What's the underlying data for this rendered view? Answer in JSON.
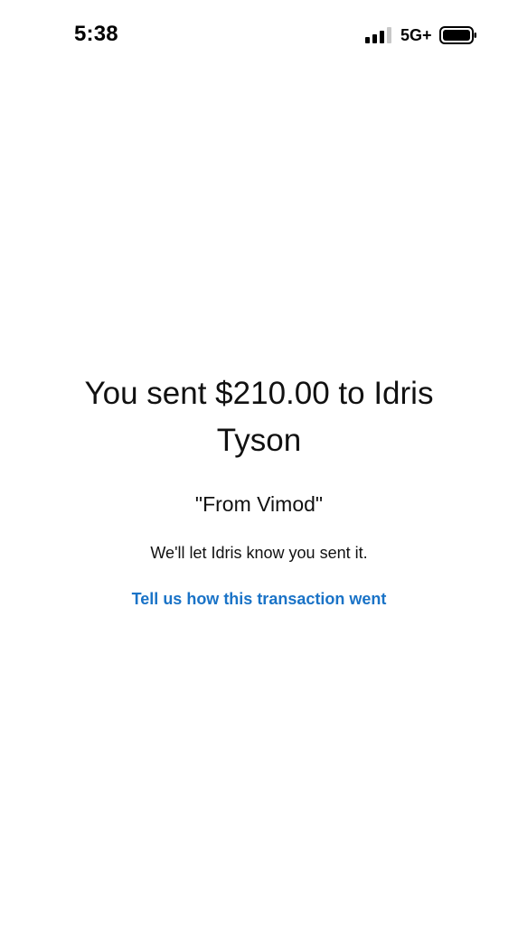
{
  "status_bar": {
    "time": "5:38",
    "network": "5G+",
    "icons": [
      "signal-bars-icon",
      "battery-icon"
    ]
  },
  "confirmation": {
    "headline": "You sent $210.00 to Idris Tyson",
    "note": "\"From Vimod\"",
    "info": "We'll let Idris know you sent it.",
    "feedback_link": "Tell us how this transaction went"
  },
  "colors": {
    "link": "#1a73c7",
    "text": "#111111",
    "background": "#ffffff"
  }
}
